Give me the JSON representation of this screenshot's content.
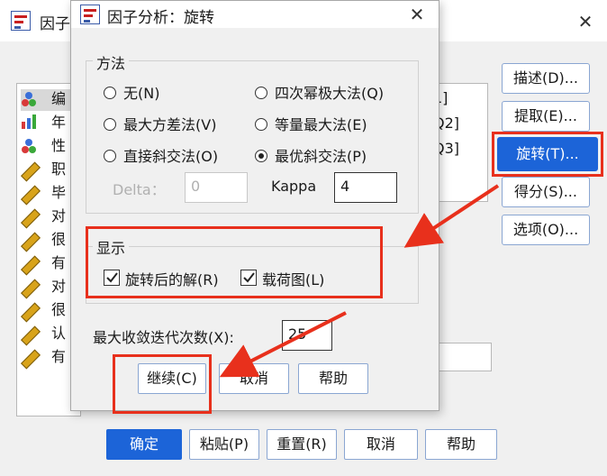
{
  "parent": {
    "title": "因子",
    "variables": [
      {
        "text": "编",
        "icon": "nominal-icon"
      },
      {
        "text": "年",
        "icon": "ordinal-icon"
      },
      {
        "text": "性",
        "icon": "nominal-icon"
      },
      {
        "text": "职",
        "icon": "scale-icon"
      },
      {
        "text": "毕",
        "icon": "scale-icon"
      },
      {
        "text": "对",
        "icon": "scale-icon"
      },
      {
        "text": "很",
        "icon": "scale-icon"
      },
      {
        "text": "有",
        "icon": "scale-icon"
      },
      {
        "text": "对",
        "icon": "scale-icon"
      },
      {
        "text": "很",
        "icon": "scale-icon"
      },
      {
        "text": "认",
        "icon": "scale-icon"
      },
      {
        "text": "有",
        "icon": "scale-icon"
      }
    ],
    "target_vars": [
      "1]",
      "Q2]",
      "Q3]"
    ],
    "side_buttons": {
      "describe": "描述(D)...",
      "extract": "提取(E)...",
      "rotate": "旋转(T)...",
      "scores": "得分(S)...",
      "options": "选项(O)..."
    },
    "bottom_buttons": {
      "ok": "确定",
      "paste": "粘贴(P)",
      "reset": "重置(R)",
      "cancel": "取消",
      "help": "帮助"
    }
  },
  "dialog": {
    "title": "因子分析：旋转",
    "method_group": "方法",
    "methods": {
      "none": "无(N)",
      "quartimax": "四次幂极大法(Q)",
      "varimax": "最大方差法(V)",
      "equamax": "等量最大法(E)",
      "oblimin": "直接斜交法(O)",
      "promax": "最优斜交法(P)"
    },
    "selected_method": "promax",
    "delta_label": "Delta：",
    "delta_value": "0",
    "kappa_label": "Kappa",
    "kappa_value": "4",
    "display_group": "显示",
    "rotated_solution": "旋转后的解(R)",
    "loading_plot": "载荷图(L)",
    "rotated_solution_checked": true,
    "loading_plot_checked": true,
    "max_iter_label": "最大收敛迭代次数(X):",
    "max_iter_value": "25",
    "buttons": {
      "continue": "继续(C)",
      "cancel": "取消",
      "help": "帮助"
    }
  },
  "colors": {
    "accent": "#1c64d8",
    "highlight": "#e8301c"
  }
}
